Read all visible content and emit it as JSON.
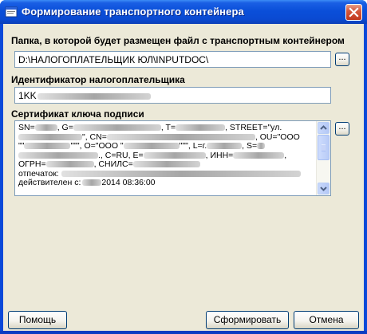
{
  "window": {
    "title": "Формирование транспортного контейнера",
    "title_color": "#ffffff",
    "frame_color": "#0a4fd9",
    "body_color": "#ece9d8"
  },
  "folder": {
    "label": "Папка, в которой будет размещен файл с транспортным контейнером",
    "value": "D:\\НАЛОГОПЛАТЕЛЬЩИК ЮЛ\\INPUTDOC\\",
    "browse_label": "..."
  },
  "taxpayer": {
    "label": "Идентификатор налогоплательщика",
    "value_prefix": "1KK"
  },
  "certificate": {
    "label": "Сертификат ключа подписи",
    "browse_label": "...",
    "lines": [
      {
        "a": "SN=",
        "b": ", G=",
        "c": ", T=",
        "d": ", STREET=\"ул."
      },
      {
        "a": "",
        "b": "\", CN=",
        "c": "",
        "d": ", OU=\"ООО"
      },
      {
        "a": "\"\"",
        "b": "\"\"\", O=\"ООО \"",
        "c": "\"\"\", L=г.",
        "d": ", S="
      },
      {
        "a": "",
        "b": "., C=RU, E=",
        "c": ", ИНН=",
        "d": ","
      },
      {
        "a": "ОГРН=",
        "b": ", СНИЛС=",
        "c": "",
        "d": ""
      },
      {
        "a": "отпечаток:",
        "b": "",
        "c": "",
        "d": ""
      },
      {
        "a": "действителен с:",
        "b": "2014 08:36:00",
        "c": "",
        "d": ""
      }
    ]
  },
  "buttons": {
    "help": "Помощь",
    "generate": "Сформировать",
    "cancel": "Отмена"
  },
  "icons": {
    "app": "app-window-icon",
    "close": "close-icon",
    "scroll_up": "scroll-up-arrow-icon",
    "scroll_down": "scroll-down-arrow-icon"
  }
}
